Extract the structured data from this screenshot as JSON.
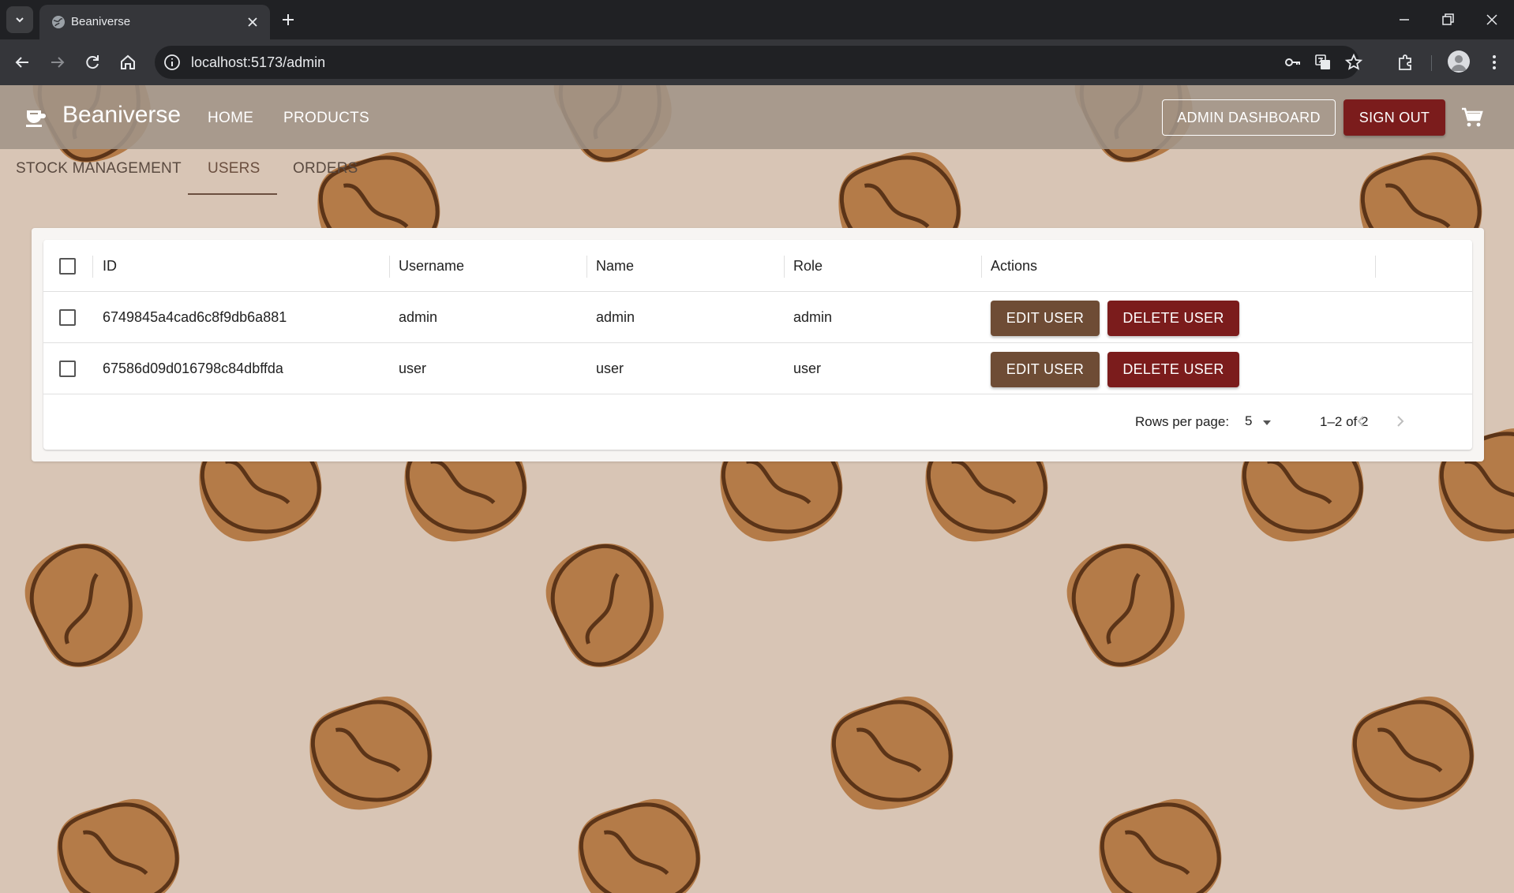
{
  "browser": {
    "tab_title": "Beaniverse",
    "url": "localhost:5173/admin",
    "icons": [
      "tab-search-icon",
      "globe-icon",
      "close-icon",
      "plus-icon",
      "minimize-icon",
      "restore-icon",
      "window-close-icon",
      "back-icon",
      "forward-icon",
      "reload-icon",
      "home-icon",
      "info-icon",
      "key-icon",
      "translate-icon",
      "star-icon",
      "extensions-icon",
      "profile-icon",
      "kebab-menu-icon"
    ]
  },
  "appbar": {
    "brand": "Beaniverse",
    "nav": {
      "home": "HOME",
      "products": "PRODUCTS"
    },
    "admin_dashboard": "ADMIN DASHBOARD",
    "sign_out": "SIGN OUT",
    "colors": {
      "appbar": "#a09488",
      "danger": "#7b1c1c",
      "primary": "#6e4c35",
      "background": "#d8c5b5"
    }
  },
  "admin_tabs": {
    "stock": "STOCK MANAGEMENT",
    "users": "USERS",
    "orders": "ORDERS",
    "active": "USERS"
  },
  "table": {
    "columns": {
      "id": "ID",
      "username": "Username",
      "name": "Name",
      "role": "Role",
      "actions": "Actions"
    },
    "rows": [
      {
        "id": "6749845a4cad6c8f9db6a881",
        "username": "admin",
        "name": "admin",
        "role": "admin"
      },
      {
        "id": "67586d09d016798c84dbffda",
        "username": "user",
        "name": "user",
        "role": "user"
      }
    ],
    "edit_label": "EDIT USER",
    "delete_label": "DELETE USER"
  },
  "pagination": {
    "rows_per_page_label": "Rows per page:",
    "rows_per_page": "5",
    "range": "1–2 of 2"
  }
}
